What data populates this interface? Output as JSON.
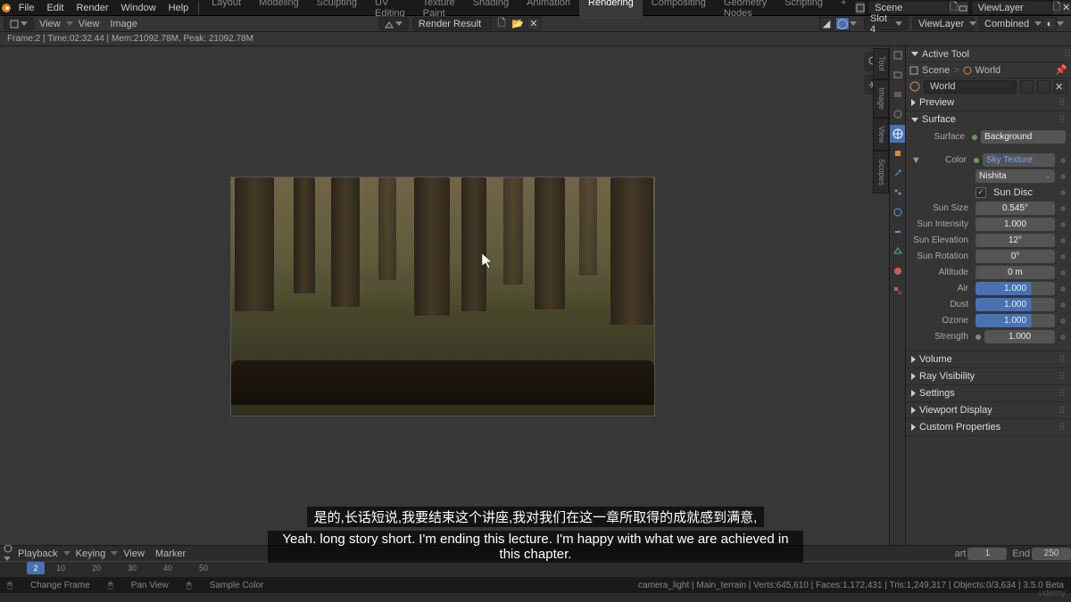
{
  "app": {
    "name": "Blender"
  },
  "menus": [
    "File",
    "Edit",
    "Render",
    "Window",
    "Help"
  ],
  "workspaces": [
    "Layout",
    "Modeling",
    "Sculpting",
    "UV Editing",
    "Texture Paint",
    "Shading",
    "Animation",
    "Rendering",
    "Compositing",
    "Geometry Nodes",
    "Scripting"
  ],
  "active_workspace": "Rendering",
  "header_right": {
    "scene": "Scene",
    "viewlayer": "ViewLayer"
  },
  "image_editor": {
    "menus": [
      "View",
      "View",
      "Image"
    ],
    "image_name": "Render Result",
    "slot": "Slot 4",
    "layer": "ViewLayer",
    "pass": "Combined",
    "status": "Frame:2 | Time:02:32.44 | Mem:21092.78M, Peak: 21092.78M"
  },
  "side_tabs": [
    "Tool",
    "Image",
    "View",
    "Scopes"
  ],
  "active_tool": "Active Tool",
  "breadcrumb": {
    "scene": "Scene",
    "world": "World"
  },
  "world_name": "World",
  "panels": {
    "preview": "Preview",
    "surface": "Surface",
    "volume": "Volume",
    "ray_visibility": "Ray Visibility",
    "settings": "Settings",
    "viewport_display": "Viewport Display",
    "custom_properties": "Custom Properties"
  },
  "surface": {
    "surface_label": "Surface",
    "surface_val": "Background",
    "color_label": "Color",
    "color_val": "Sky Texture",
    "sky_type": "Nishita",
    "sun_disc_label": "Sun Disc",
    "sun_size_label": "Sun Size",
    "sun_size_val": "0.545°",
    "sun_intensity_label": "Sun Intensity",
    "sun_intensity_val": "1.000",
    "sun_elevation_label": "Sun Elevation",
    "sun_elevation_val": "12°",
    "sun_rotation_label": "Sun Rotation",
    "sun_rotation_val": "0°",
    "altitude_label": "Altitude",
    "altitude_val": "0 m",
    "air_label": "Air",
    "air_val": "1.000",
    "dust_label": "Dust",
    "dust_val": "1.000",
    "ozone_label": "Ozone",
    "ozone_val": "1.000",
    "strength_label": "Strength",
    "strength_val": "1.000"
  },
  "timeline": {
    "menus": [
      "Playback",
      "Keying",
      "View",
      "Marker"
    ],
    "start_label": "art",
    "start_val": "1",
    "end_label": "End",
    "end_val": "250",
    "current": "2",
    "ticks": [
      "10",
      "20",
      "30",
      "40",
      "50"
    ]
  },
  "statusbar": {
    "left1": "Change Frame",
    "left2": "Pan View",
    "left3": "Sample Color",
    "right": "camera_light | Main_terrain  | Verts:645,610 | Faces:1,172,431 | Tris:1,249,317 | Objects:0/3,634 | 3.5.0 Beta"
  },
  "subtitles": {
    "line1": "是的,长话短说,我要结束这个讲座,我对我们在这一章所取得的成就感到满意,",
    "line2": "Yeah. long story short. I'm ending this lecture. I'm happy with what we are achieved in this chapter."
  },
  "watermark": "udemy"
}
